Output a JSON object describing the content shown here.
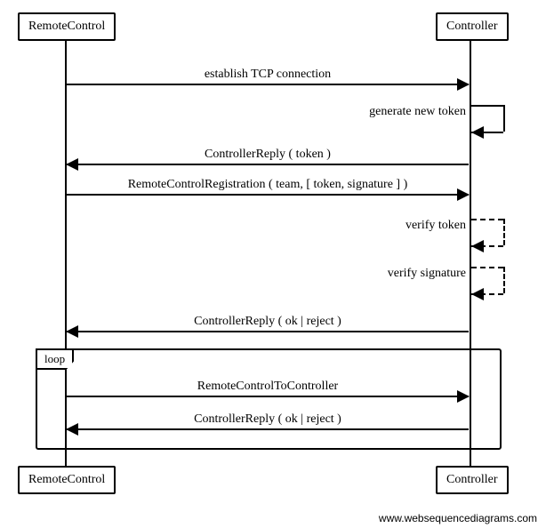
{
  "participants": {
    "left": "RemoteControl",
    "right": "Controller"
  },
  "messages": {
    "m1": "establish TCP connection",
    "m2": "generate new token",
    "m3": "ControllerReply ( token )",
    "m4": "RemoteControlRegistration ( team, [ token, signature ] )",
    "m5": "verify token",
    "m6": "verify signature",
    "m7": "ControllerReply ( ok | reject )",
    "m8": "RemoteControlToController",
    "m9": "ControllerReply ( ok | reject )"
  },
  "loopLabel": "loop",
  "watermark": "www.websequencediagrams.com",
  "chart_data": {
    "type": "sequence-diagram",
    "participants": [
      "RemoteControl",
      "Controller"
    ],
    "steps": [
      {
        "from": "RemoteControl",
        "to": "Controller",
        "label": "establish TCP connection",
        "kind": "sync"
      },
      {
        "from": "Controller",
        "to": "Controller",
        "label": "generate new token",
        "kind": "self"
      },
      {
        "from": "Controller",
        "to": "RemoteControl",
        "label": "ControllerReply ( token )",
        "kind": "sync"
      },
      {
        "from": "RemoteControl",
        "to": "Controller",
        "label": "RemoteControlRegistration ( team, [ token, signature ] )",
        "kind": "sync"
      },
      {
        "from": "Controller",
        "to": "Controller",
        "label": "verify token",
        "kind": "self-dash"
      },
      {
        "from": "Controller",
        "to": "Controller",
        "label": "verify signature",
        "kind": "self-dash"
      },
      {
        "from": "Controller",
        "to": "RemoteControl",
        "label": "ControllerReply ( ok | reject )",
        "kind": "sync"
      },
      {
        "fragment": "loop",
        "steps": [
          {
            "from": "RemoteControl",
            "to": "Controller",
            "label": "RemoteControlToController",
            "kind": "sync"
          },
          {
            "from": "Controller",
            "to": "RemoteControl",
            "label": "ControllerReply ( ok | reject )",
            "kind": "sync"
          }
        ]
      }
    ]
  }
}
